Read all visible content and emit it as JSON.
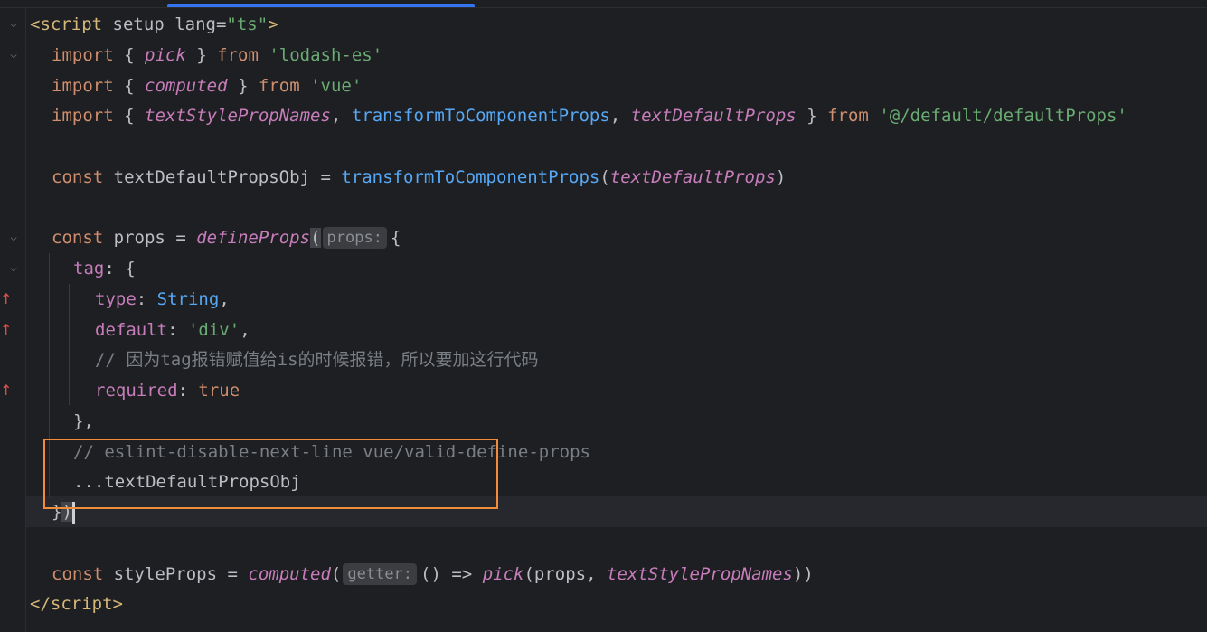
{
  "editor": {
    "line1": {
      "open": "<",
      "tag": "script",
      "attr1": "setup",
      "attr2": "lang",
      "eq": "=",
      "val": "\"ts\"",
      "close": ">"
    },
    "line2": {
      "import": "import",
      "lb": "{",
      "name": "pick",
      "rb": "}",
      "from": "from",
      "src": "'lodash-es'"
    },
    "line3": {
      "import": "import",
      "lb": "{",
      "name": "computed",
      "rb": "}",
      "from": "from",
      "src": "'vue'"
    },
    "line4": {
      "import": "import",
      "lb": "{",
      "n1": "textStylePropNames",
      "c1": ",",
      "n2": "transformToComponentProps",
      "c2": ",",
      "n3": "textDefaultProps",
      "rb": "}",
      "from": "from",
      "src": "'@/default/defaultProps'"
    },
    "line5": {
      "const": "const",
      "name": "textDefaultPropsObj",
      "eq": "=",
      "fn": "transformToComponentProps",
      "lp": "(",
      "arg": "textDefaultProps",
      "rp": ")"
    },
    "line6": {
      "const": "const",
      "name": "props",
      "eq": "=",
      "fn": "defineProps",
      "lp": "(",
      "hint": "props:",
      "lb": "{"
    },
    "line7": {
      "key": "tag",
      "colon": ":",
      "lb": "{"
    },
    "line8": {
      "key": "type",
      "colon": ":",
      "val": "String",
      "comma": ","
    },
    "line9": {
      "key": "default",
      "colon": ":",
      "val": "'div'",
      "comma": ","
    },
    "line10": {
      "comment": "// 因为tag报错赋值给is的时候报错，所以要加这行代码"
    },
    "line11": {
      "key": "required",
      "colon": ":",
      "val": "true"
    },
    "line12": {
      "text": "},"
    },
    "line13": {
      "comment": "// eslint-disable-next-line vue/valid-define-props"
    },
    "line14": {
      "text": "...textDefaultPropsObj"
    },
    "line15": {
      "rb": "}",
      "rp": ")"
    },
    "line16": {
      "const": "const",
      "name": "styleProps",
      "eq": "=",
      "fn": "computed",
      "lp": "(",
      "hint": "getter:",
      "arrow": "() =>",
      "fn2": "pick",
      "lp2": "(",
      "arg1": "props",
      "comma": ",",
      "arg2": "textStylePropNames",
      "rp": "))"
    },
    "line17": {
      "open": "</",
      "tag": "script",
      "close": ">"
    }
  },
  "gutter": {
    "fold_icon": "chevron-down-icon",
    "arrow_icon": "up-arrow-icon",
    "arrow_glyph": "↑",
    "fold_glyph": "⌵"
  },
  "colors": {
    "background": "#1e1f22",
    "keyword": "#cf8e6d",
    "string": "#6aab73",
    "function_italic": "#c77dbb",
    "function": "#56a8f5",
    "comment": "#7a7e85",
    "highlight_box": "#f08c3a"
  }
}
